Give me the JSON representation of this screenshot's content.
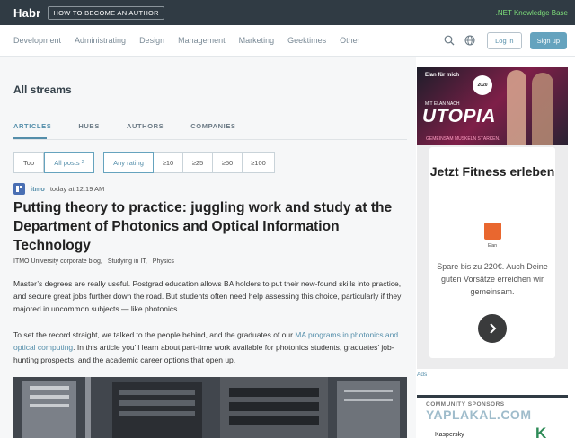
{
  "header": {
    "logo": "Habr",
    "author_button": "HOW TO BECOME AN AUTHOR",
    "knowledge_base": ".NET Knowledge Base"
  },
  "nav": {
    "items": [
      {
        "label": "Development"
      },
      {
        "label": "Administrating"
      },
      {
        "label": "Design"
      },
      {
        "label": "Management"
      },
      {
        "label": "Marketing"
      },
      {
        "label": "Geektimes"
      },
      {
        "label": "Other"
      }
    ],
    "login": "Log in",
    "signup": "Sign up",
    "search_icon": "search-icon",
    "language_icon": "globe-icon"
  },
  "page": {
    "title": "All streams",
    "tabs": [
      {
        "label": "ARTICLES",
        "active": true
      },
      {
        "label": "HUBS",
        "active": false
      },
      {
        "label": "AUTHORS",
        "active": false
      },
      {
        "label": "COMPANIES",
        "active": false
      }
    ],
    "filters": {
      "top": "Top",
      "all_posts": "All posts",
      "all_posts_count": "2",
      "any_rating": "Any rating",
      "ratings": [
        "≥10",
        "≥25",
        "≥50",
        "≥100"
      ]
    }
  },
  "post": {
    "author": "itmo",
    "time": "today at 12:19 AM",
    "title": "Putting theory to practice: juggling work and study at the Department of Photonics and Optical Information Technology",
    "hubs": [
      "ITMO University corporate blog,",
      "Studying in IT,",
      "Physics"
    ],
    "paragraph1": "Master’s degrees are really useful. Postgrad education allows BA holders to put their new-found skills into practice, and secure great jobs further down the road. But students often need help assessing this choice, particularly if they majored in uncommon subjects — like photonics.",
    "paragraph2_before": "To set the record straight, we talked to the people behind, and the graduates of our ",
    "paragraph2_link": "MA programs in photonics and optical computing",
    "paragraph2_after": ". In this article you’ll learn about part-time work available for photonics students, graduates’ job-hunting prospects, and the academic career options that open up."
  },
  "sidebar": {
    "ad": {
      "brand": "Elan für mich",
      "badge": "2020",
      "subline": "MIT ELAN NACH",
      "big": "UTOPIA",
      "tagline": "GEMEINSAM MUSKELN STÄRKEN.",
      "heading": "Jetzt Fitness erleben",
      "logo_label": "Elan",
      "text": "Spare bis zu 220€. Auch Deine guten Vorsätze erreichen wir gemeinsam."
    },
    "ads_label": "Ads",
    "sponsors": {
      "label": "COMMUNITY SPONSORS",
      "watermark": "YAPLAKAL.COM",
      "sponsor": "Kaspersky",
      "sponsor_logo": "K"
    }
  }
}
